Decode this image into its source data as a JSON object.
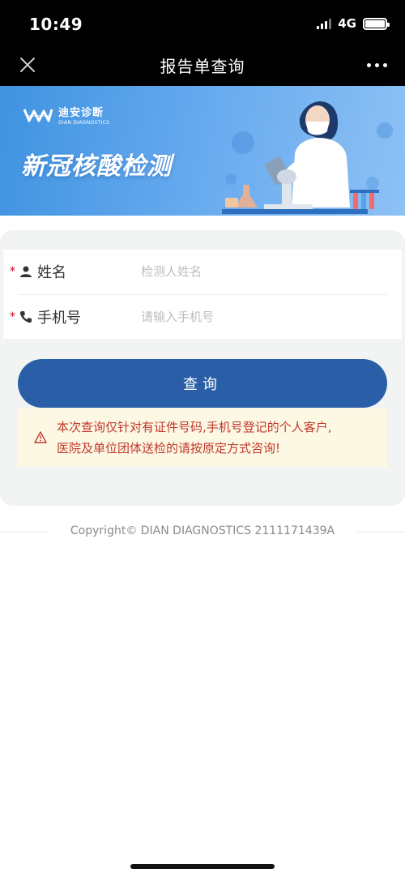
{
  "status_bar": {
    "time": "10:49",
    "network": "4G"
  },
  "nav": {
    "title": "报告单查询",
    "close_icon": "close-icon",
    "more_icon": "more-icon"
  },
  "banner": {
    "logo_cn": "迪安诊断",
    "logo_en": "DIAN DIAGNOSTICS",
    "title": "新冠核酸检测"
  },
  "form": {
    "name": {
      "required_mark": "*",
      "label": "姓名",
      "placeholder": "检测人姓名",
      "value": ""
    },
    "phone": {
      "required_mark": "*",
      "label": "手机号",
      "placeholder": "请输入手机号",
      "value": ""
    }
  },
  "query_button": {
    "label": "查询"
  },
  "notice": {
    "line1": "本次查询仅针对有证件号码,手机号登记的个人客户,",
    "line2": "医院及单位团体送检的请按原定方式咨询!"
  },
  "footer": {
    "copyright": "Copyright© DIAN DIAGNOSTICS 2111171439A"
  },
  "colors": {
    "primary": "#2a5fa8",
    "required": "#d0021b",
    "notice_text": "#c0392b",
    "notice_bg": "#fdf8e4",
    "banner": "#5aa3ec"
  }
}
